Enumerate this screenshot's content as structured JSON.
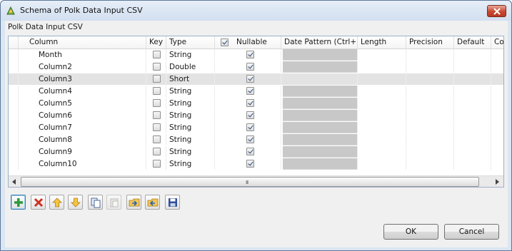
{
  "window": {
    "title": "Schema of Polk Data Input CSV"
  },
  "section_label": "Polk Data Input CSV",
  "table": {
    "headers": {
      "column": "Column",
      "key": "Key",
      "type": "Type",
      "nullable": "Nullable",
      "date_pattern": "Date Pattern (Ctrl+...",
      "length": "Length",
      "precision": "Precision",
      "default": "Default",
      "comment": "Cor"
    },
    "nullable_header_checked": true,
    "rows": [
      {
        "column": "Month",
        "key": false,
        "type": "String",
        "nullable": true,
        "date_pattern_disabled": true,
        "selected": false
      },
      {
        "column": "Column2",
        "key": false,
        "type": "Double",
        "nullable": true,
        "date_pattern_disabled": true,
        "selected": false
      },
      {
        "column": "Column3",
        "key": false,
        "type": "Short",
        "nullable": true,
        "date_pattern_disabled": false,
        "selected": true
      },
      {
        "column": "Column4",
        "key": false,
        "type": "String",
        "nullable": true,
        "date_pattern_disabled": true,
        "selected": false
      },
      {
        "column": "Column5",
        "key": false,
        "type": "String",
        "nullable": true,
        "date_pattern_disabled": true,
        "selected": false
      },
      {
        "column": "Column6",
        "key": false,
        "type": "String",
        "nullable": true,
        "date_pattern_disabled": true,
        "selected": false
      },
      {
        "column": "Column7",
        "key": false,
        "type": "String",
        "nullable": true,
        "date_pattern_disabled": true,
        "selected": false
      },
      {
        "column": "Column8",
        "key": false,
        "type": "String",
        "nullable": true,
        "date_pattern_disabled": true,
        "selected": false
      },
      {
        "column": "Column9",
        "key": false,
        "type": "String",
        "nullable": true,
        "date_pattern_disabled": true,
        "selected": false
      },
      {
        "column": "Column10",
        "key": false,
        "type": "String",
        "nullable": true,
        "date_pattern_disabled": true,
        "selected": false
      }
    ],
    "scrollbar_grip": "III"
  },
  "toolbar": {
    "buttons": [
      {
        "name": "add-row-button",
        "icon": "plus-icon",
        "enabled": true,
        "focused": true
      },
      {
        "name": "remove-row-button",
        "icon": "delete-x-icon",
        "enabled": true,
        "focused": false
      },
      {
        "name": "move-up-button",
        "icon": "arrow-up-icon",
        "enabled": true,
        "focused": false
      },
      {
        "name": "move-down-button",
        "icon": "arrow-down-icon",
        "enabled": true,
        "focused": false
      },
      {
        "name": "copy-button",
        "icon": "copy-icon",
        "enabled": true,
        "focused": false
      },
      {
        "name": "paste-button",
        "icon": "paste-icon",
        "enabled": false,
        "focused": false
      },
      {
        "name": "import-schema-button",
        "icon": "folder-import-icon",
        "enabled": true,
        "focused": false
      },
      {
        "name": "export-schema-button",
        "icon": "folder-export-icon",
        "enabled": true,
        "focused": false
      },
      {
        "name": "save-schema-button",
        "icon": "floppy-save-icon",
        "enabled": true,
        "focused": false
      }
    ]
  },
  "buttons": {
    "ok": "OK",
    "cancel": "Cancel"
  },
  "colors": {
    "title_bar": "#d2dff0",
    "close_button": "#c8462f",
    "disabled_cell": "#c8c8c8",
    "selected_row": "#e3e3e3"
  }
}
